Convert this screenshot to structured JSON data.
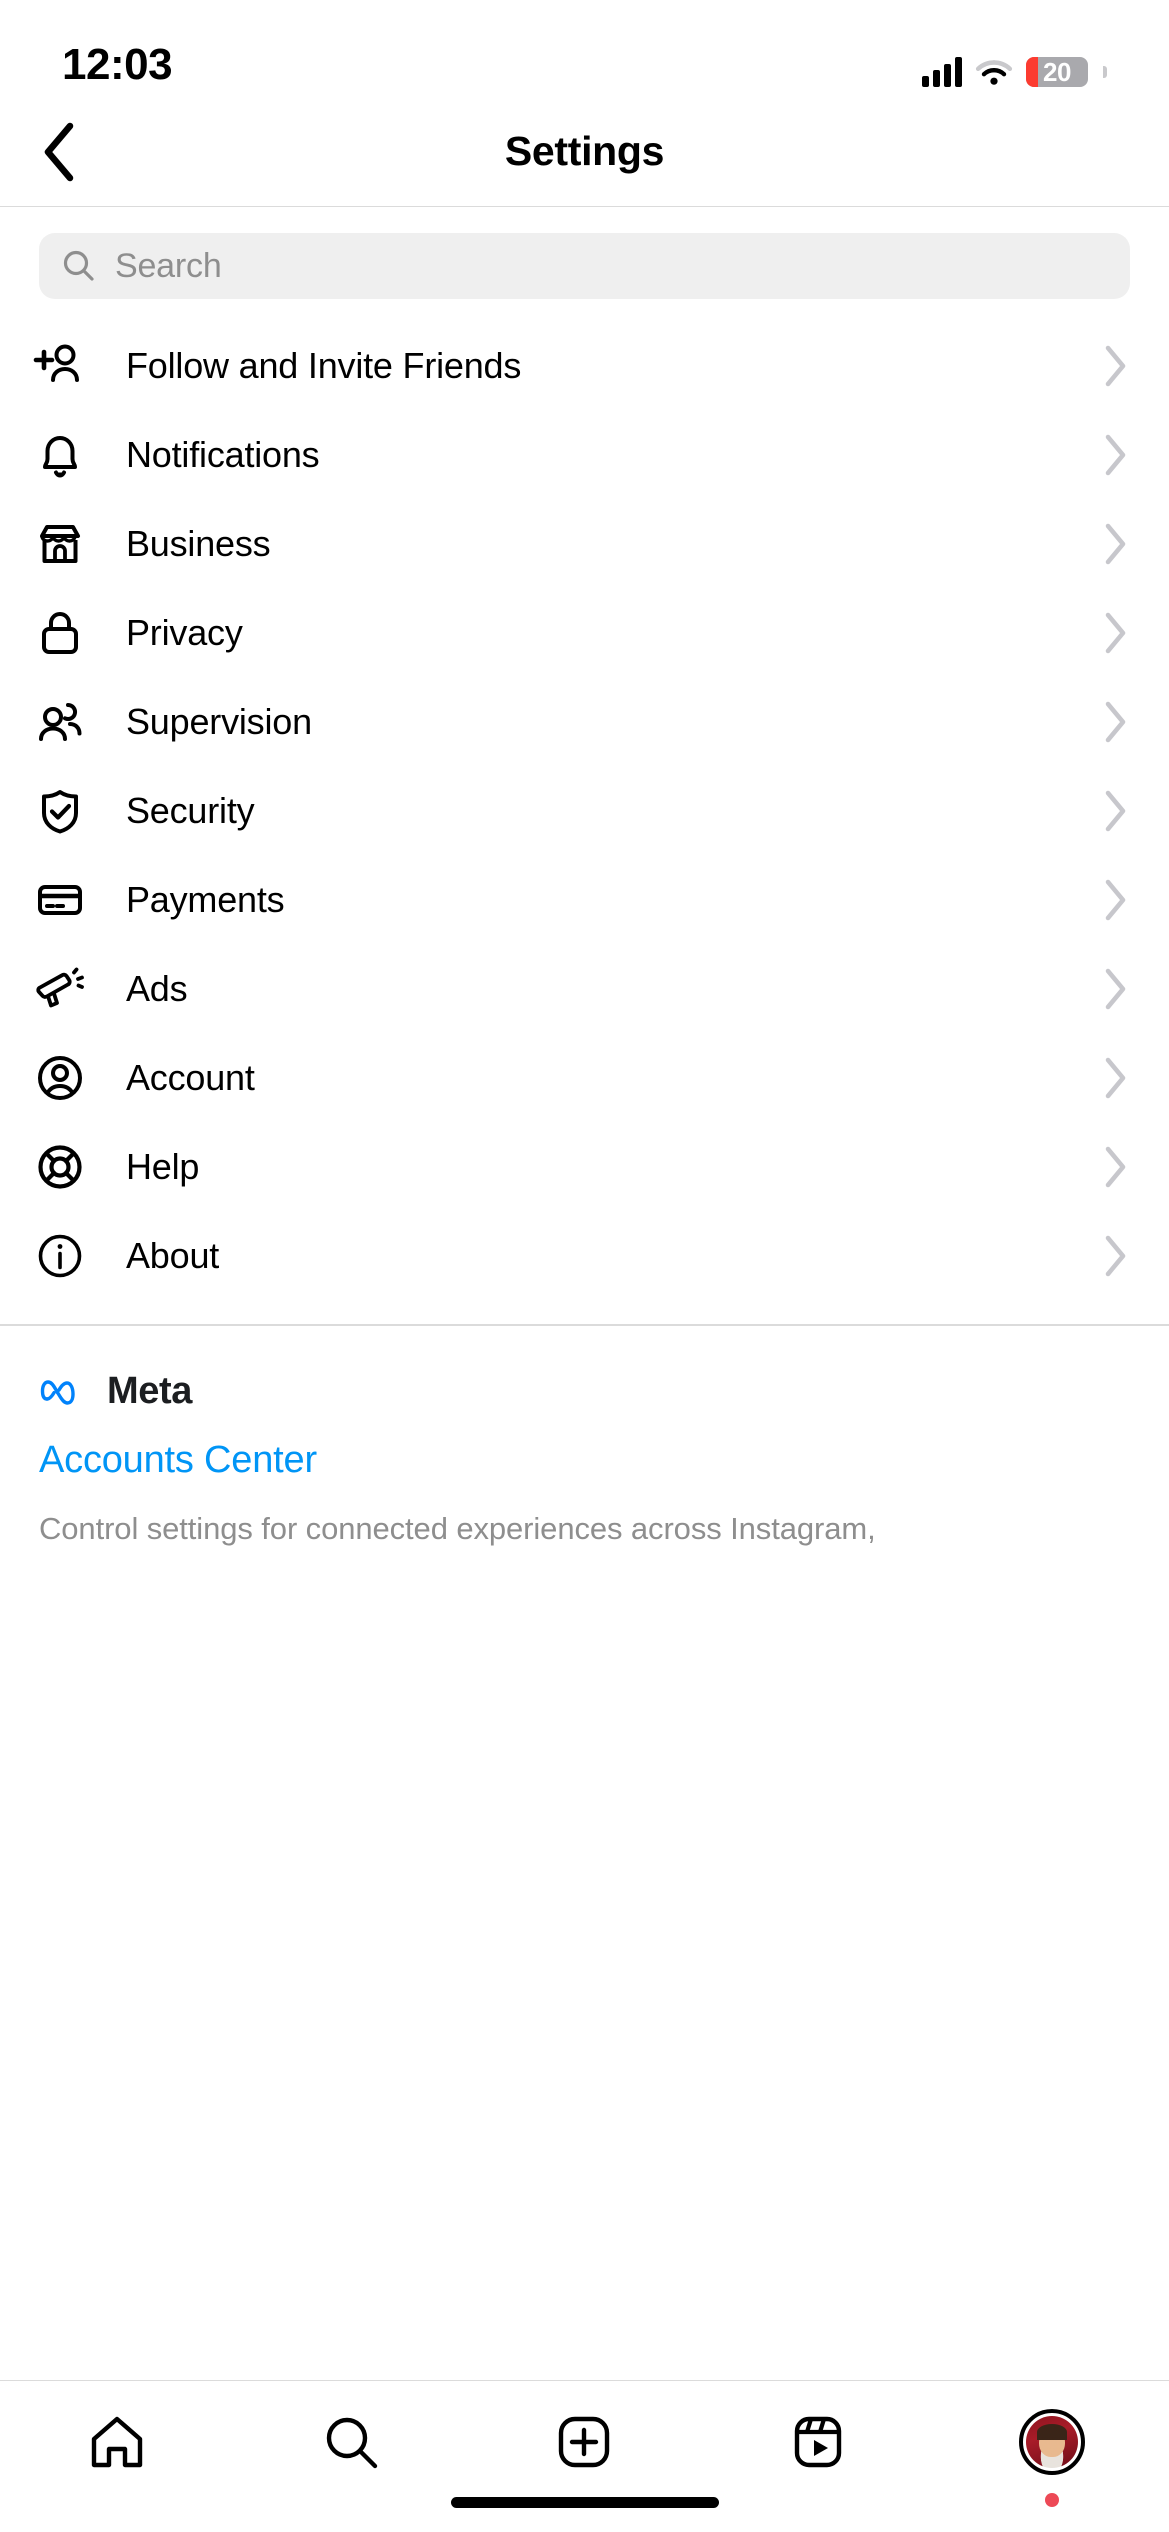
{
  "status_bar": {
    "time": "12:03",
    "cellular_icon": "cellular-signal-icon",
    "wifi_icon": "wifi-icon",
    "battery_icon": "battery-icon",
    "battery_level": "20",
    "battery_percent": 20,
    "battery_color": "#fc3b30"
  },
  "header": {
    "back_icon": "chevron-left-icon",
    "title": "Settings"
  },
  "search": {
    "icon": "search-icon",
    "placeholder": "Search",
    "value": "",
    "background": "#efefef",
    "placeholder_color": "#8e8e8e"
  },
  "settings": {
    "items": [
      {
        "label": "Follow and Invite Friends",
        "icon": "person-plus-icon",
        "chevron": "chevron-right-icon"
      },
      {
        "label": "Notifications",
        "icon": "bell-icon",
        "chevron": "chevron-right-icon"
      },
      {
        "label": "Business",
        "icon": "storefront-icon",
        "chevron": "chevron-right-icon"
      },
      {
        "label": "Privacy",
        "icon": "lock-icon",
        "chevron": "chevron-right-icon"
      },
      {
        "label": "Supervision",
        "icon": "two-people-icon",
        "chevron": "chevron-right-icon"
      },
      {
        "label": "Security",
        "icon": "shield-check-icon",
        "chevron": "chevron-right-icon"
      },
      {
        "label": "Payments",
        "icon": "credit-card-icon",
        "chevron": "chevron-right-icon"
      },
      {
        "label": "Ads",
        "icon": "megaphone-icon",
        "chevron": "chevron-right-icon"
      },
      {
        "label": "Account",
        "icon": "account-circle-icon",
        "chevron": "chevron-right-icon"
      },
      {
        "label": "Help",
        "icon": "life-ring-icon",
        "chevron": "chevron-right-icon"
      },
      {
        "label": "About",
        "icon": "info-circle-icon",
        "chevron": "chevron-right-icon"
      }
    ]
  },
  "meta": {
    "logo_icon": "meta-logo-icon",
    "brand_name": "Meta",
    "accounts_center_label": "Accounts Center",
    "description": "Control settings for connected experiences across Instagram,",
    "link_color": "#0095f6",
    "logo_color": "#0082fb"
  },
  "tabbar": {
    "items": [
      {
        "name": "home",
        "icon": "home-icon"
      },
      {
        "name": "search",
        "icon": "search-icon"
      },
      {
        "name": "create",
        "icon": "plus-square-icon"
      },
      {
        "name": "reels",
        "icon": "reels-icon"
      },
      {
        "name": "profile",
        "icon": "profile-avatar-icon"
      }
    ],
    "profile_badge_color": "#ed4956"
  }
}
